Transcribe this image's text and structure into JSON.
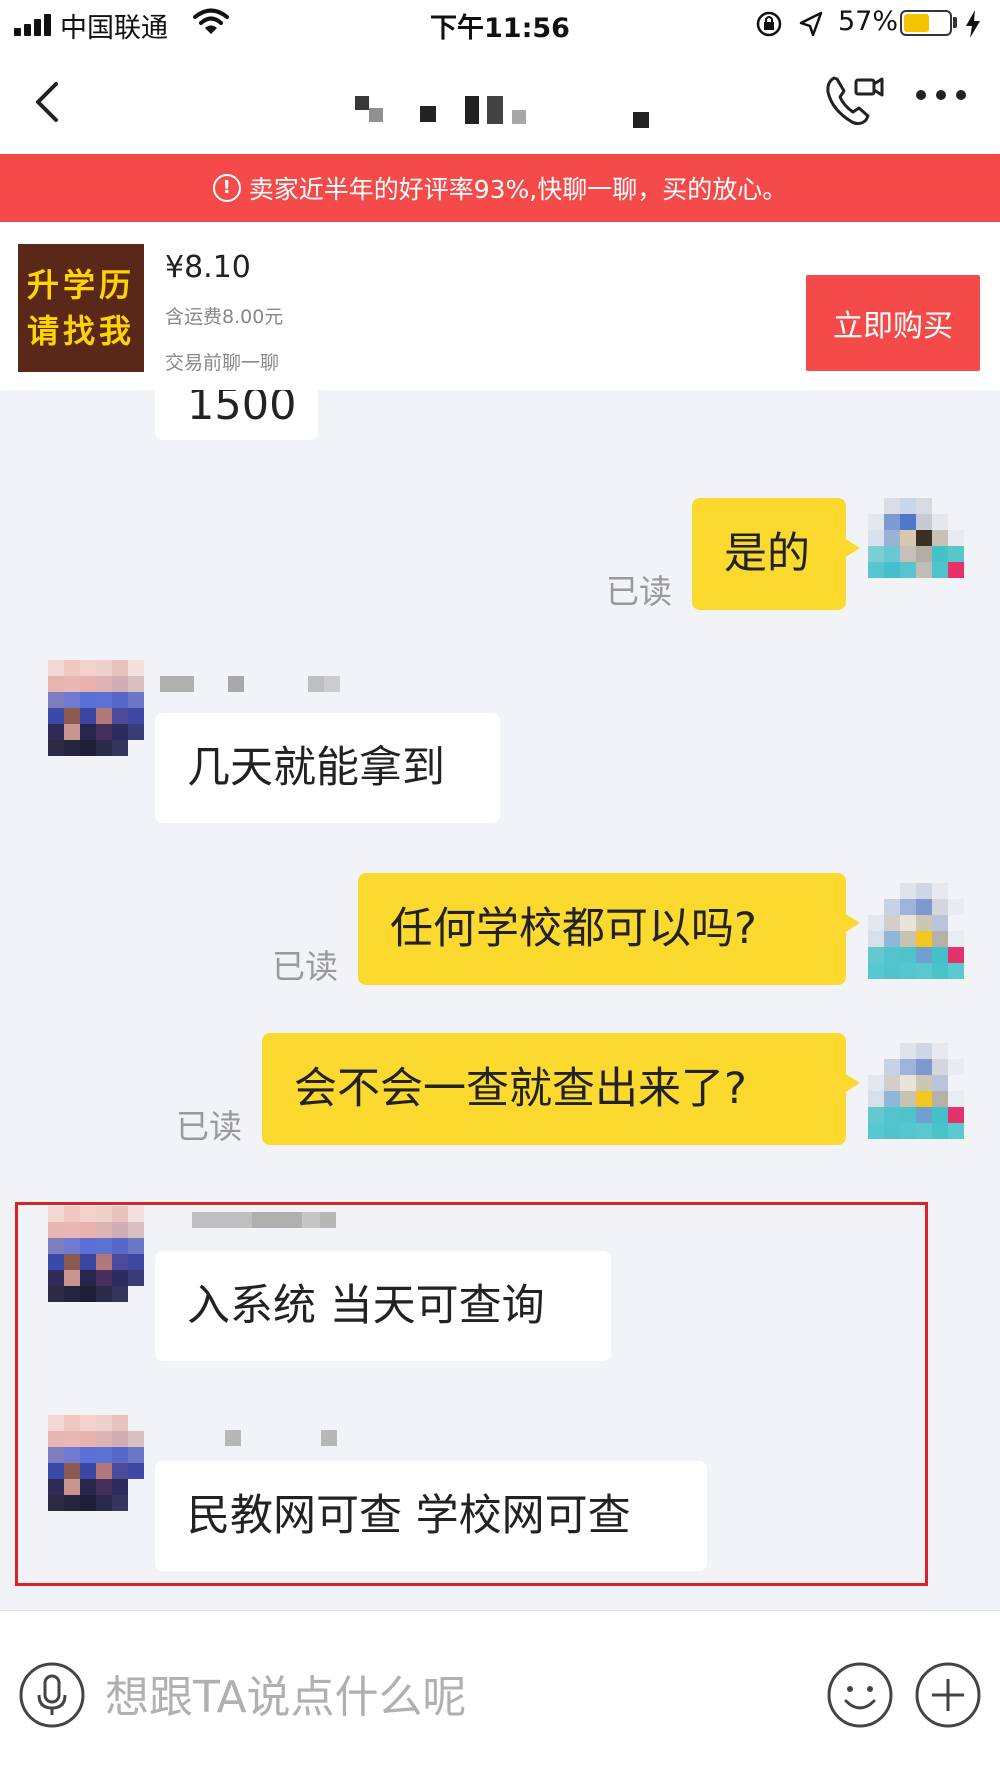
{
  "status_bar": {
    "carrier": "中国联通",
    "time": "下午11:56",
    "battery_percent": "57%",
    "battery_level": 0.57,
    "battery_color": "#f5c400"
  },
  "nav": {
    "back_icon": "chevron-left-icon",
    "call_icon": "video-call-icon",
    "more_icon": "more-dots-icon"
  },
  "banner": {
    "icon": "info-circle-icon",
    "text": "卖家近半年的好评率93%,快聊一聊，买的放心。",
    "color": "#f44a4a"
  },
  "product": {
    "image_text": [
      "升学历",
      "请找我"
    ],
    "price": "¥8.10",
    "shipping": "含运费8.00元",
    "chat_hint": "交易前聊一聊",
    "buy_label": "立即购买"
  },
  "messages": [
    {
      "from": "seller",
      "text": "1500",
      "partial": true
    },
    {
      "from": "me",
      "text": "是的",
      "status": "已读"
    },
    {
      "from": "seller",
      "text": "几天就能拿到"
    },
    {
      "from": "me",
      "text": "任何学校都可以吗?",
      "status": "已读"
    },
    {
      "from": "me",
      "text": "会不会一查就查出来了?",
      "status": "已读"
    },
    {
      "from": "seller",
      "text": "入系统 当天可查询",
      "highlighted": true
    },
    {
      "from": "seller",
      "text": "民教网可查 学校网可查",
      "highlighted": true
    }
  ],
  "input_bar": {
    "placeholder": "想跟TA说点什么呢",
    "voice_icon": "microphone-icon",
    "emoji_icon": "smiley-icon",
    "plus_icon": "plus-circle-icon"
  },
  "colors": {
    "accent_red": "#f44a4a",
    "bubble_out": "#fbd92e",
    "bubble_in": "#ffffff",
    "chat_bg": "#f2f3f7",
    "highlight_border": "#d8232a"
  }
}
